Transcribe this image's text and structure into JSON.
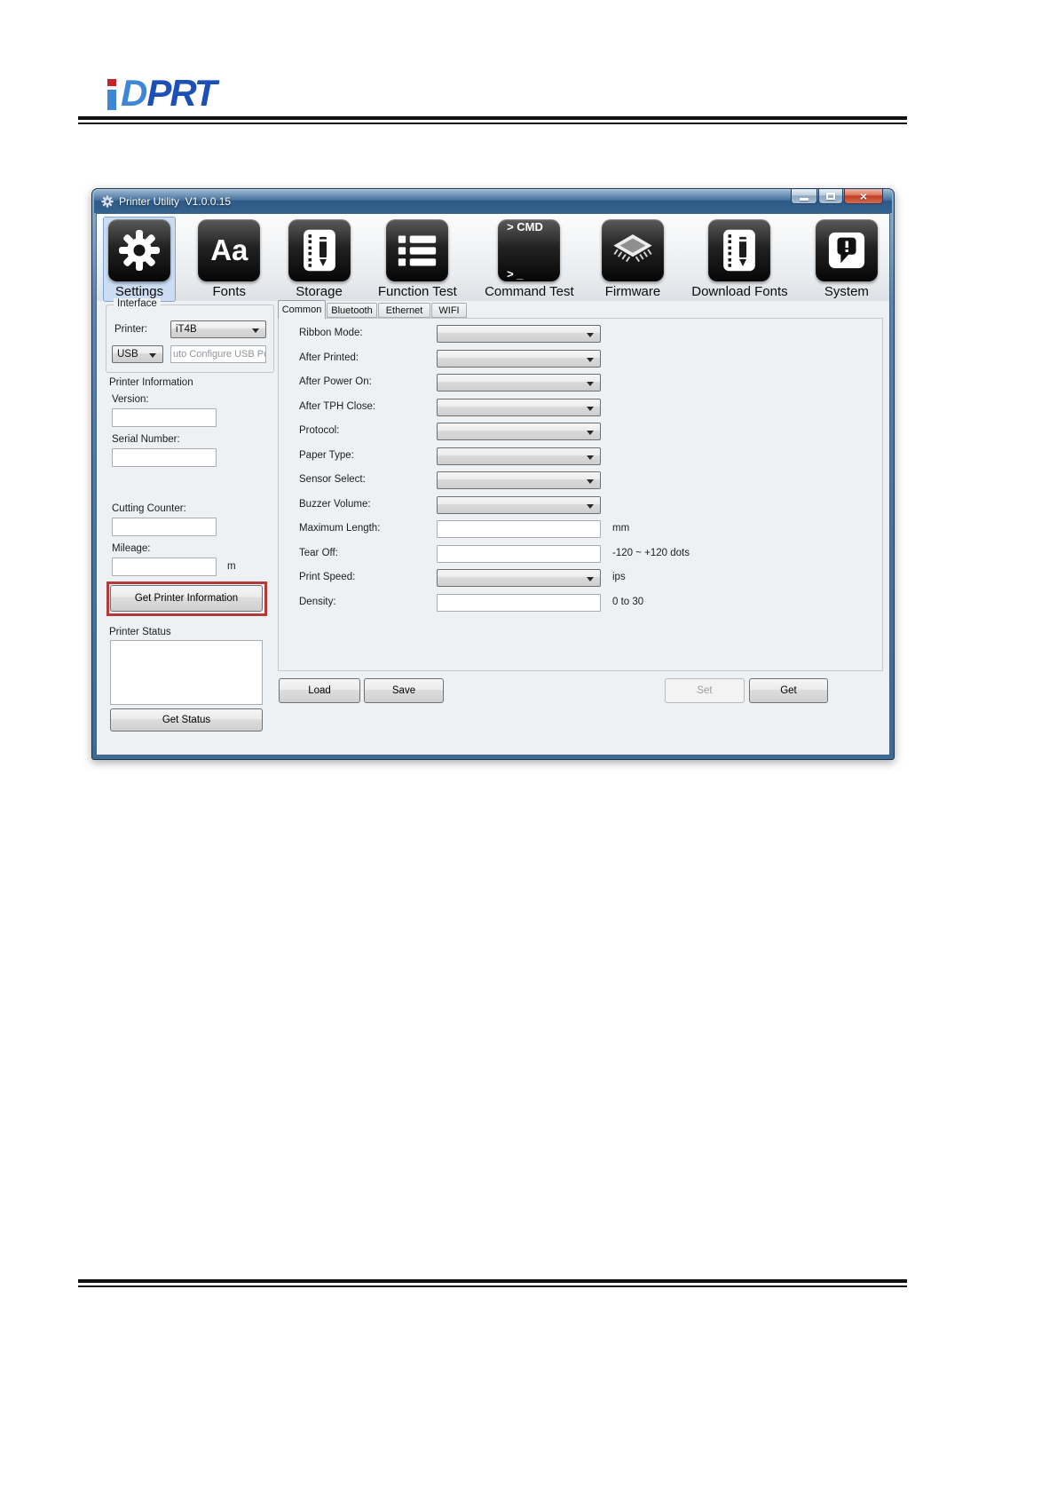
{
  "logo": {
    "letter_d": "D",
    "letters_prt": "PRT"
  },
  "window": {
    "title": "Printer Utility  V1.0.0.15",
    "controls": {
      "minimize": "minimize",
      "maximize": "maximize",
      "close": "close"
    }
  },
  "toolbar": {
    "items": [
      {
        "label": "Settings",
        "icon": "gear-icon",
        "selected": true
      },
      {
        "label": "Fonts",
        "icon": "fonts-aa-icon",
        "icon_text": "Aa"
      },
      {
        "label": "Storage",
        "icon": "notebook-pencil-icon"
      },
      {
        "label": "Function Test",
        "icon": "list-icon"
      },
      {
        "label": "Command Test",
        "icon": "terminal-cmd-icon",
        "cmd_line1": "> CMD",
        "cmd_line2": "> _"
      },
      {
        "label": "Firmware",
        "icon": "chip-icon"
      },
      {
        "label": "Download Fonts",
        "icon": "notebook-pencil-icon"
      },
      {
        "label": "System",
        "icon": "exclamation-bubble-icon"
      }
    ]
  },
  "sidebar": {
    "interface": {
      "title": "Interface",
      "printer_label": "Printer:",
      "printer_value": "iT4B",
      "port_value": "USB",
      "usb_text": "uto Configure USB Po"
    },
    "info": {
      "title": "Printer Information",
      "version_label": "Version:",
      "serial_label": "Serial Number:",
      "cutting_label": "Cutting Counter:",
      "mileage_label": "Mileage:",
      "mileage_unit": "m",
      "get_info_button": "Get Printer Information"
    },
    "status": {
      "title": "Printer Status",
      "get_status_button": "Get Status"
    }
  },
  "main": {
    "tabs": [
      {
        "label": "Common",
        "active": true
      },
      {
        "label": "Bluetooth",
        "active": false
      },
      {
        "label": "Ethernet",
        "active": false
      },
      {
        "label": "WIFI",
        "active": false
      }
    ],
    "form": [
      {
        "label": "Ribbon Mode:",
        "control": "select"
      },
      {
        "label": "After Printed:",
        "control": "select"
      },
      {
        "label": "After Power On:",
        "control": "select"
      },
      {
        "label": "After TPH Close:",
        "control": "select"
      },
      {
        "label": "Protocol:",
        "control": "select"
      },
      {
        "label": "Paper Type:",
        "control": "select"
      },
      {
        "label": "Sensor Select:",
        "control": "select"
      },
      {
        "label": "Buzzer Volume:",
        "control": "select"
      },
      {
        "label": "Maximum Length:",
        "control": "input",
        "unit": "mm"
      },
      {
        "label": "Tear Off:",
        "control": "input",
        "unit": "-120 ~ +120 dots"
      },
      {
        "label": "Print Speed:",
        "control": "select",
        "unit": "ips"
      },
      {
        "label": "Density:",
        "control": "input",
        "unit": "0 to 30"
      }
    ],
    "buttons": {
      "load": "Load",
      "save": "Save",
      "set": "Set",
      "get": "Get"
    }
  },
  "colors": {
    "titlebar_blue": "#35618e",
    "selected_highlight": "#cbdcf3",
    "annotation_red": "#b43a3a",
    "toolbar_icon_bg": "#1c1c1c",
    "logo_blue_light": "#3f86d6",
    "logo_blue_dark": "#1c4fb8",
    "logo_red": "#c4252b"
  }
}
